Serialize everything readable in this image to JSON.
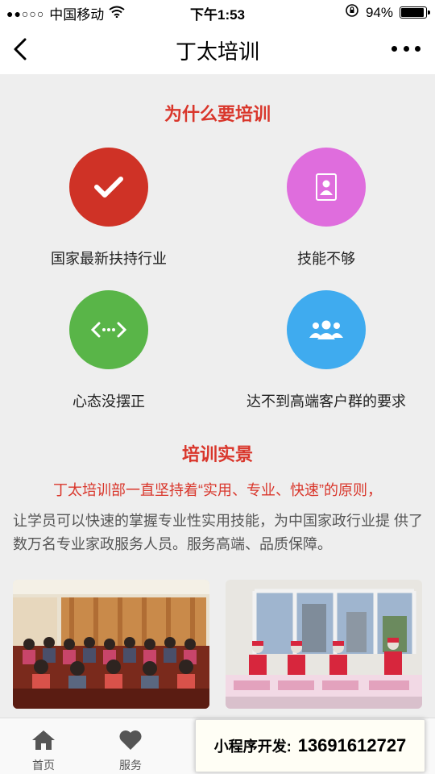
{
  "status_bar": {
    "signal": "●●○○○",
    "carrier": "中国移动",
    "time": "下午1:53",
    "battery_text": "94%",
    "battery_level": 0.94
  },
  "nav": {
    "title": "丁太培训"
  },
  "why": {
    "title": "为什么要培训",
    "items": [
      {
        "label": "国家最新扶持行业",
        "color": "#cf3226",
        "icon": "check-icon"
      },
      {
        "label": "技能不够",
        "color": "#df6ddd",
        "icon": "id-card-icon"
      },
      {
        "label": "心态没摆正",
        "color": "#59b548",
        "icon": "code-arrows-icon"
      },
      {
        "label": "达不到高端客户群的要求",
        "color": "#3fabef",
        "icon": "group-icon"
      }
    ]
  },
  "scene": {
    "title": "培训实景",
    "highlight": "丁太培训部一直坚持着“实用、专业、快速”的原则，",
    "description": "让学员可以快速的掌握专业性实用技能，为中国家政行业提 供了数万名专业家政服务人员。服务高端、品质保障。"
  },
  "tabs": [
    {
      "label": "首页",
      "icon": "home-icon"
    },
    {
      "label": "服务",
      "icon": "heart-icon"
    }
  ],
  "promo": {
    "label": "小程序开发:",
    "phone": "13691612727"
  },
  "colors": {
    "accent": "#d9362b",
    "background": "#eeeeee"
  }
}
